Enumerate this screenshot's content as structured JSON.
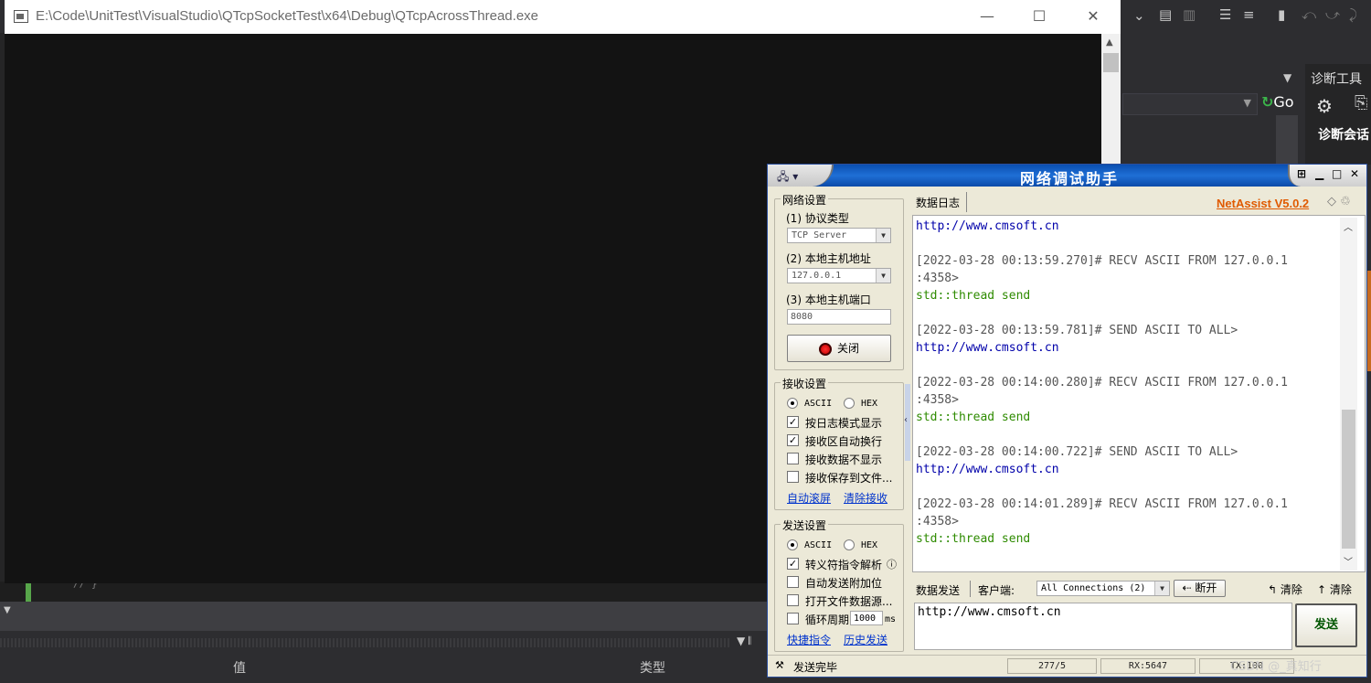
{
  "console": {
    "title": "E:\\Code\\UnitTest\\VisualStudio\\QTcpSocketTest\\x64\\Debug\\QTcpAcrossThread.exe",
    "minimize": "—",
    "maximize": "☐",
    "close": "✕"
  },
  "vs": {
    "go_label": "Go",
    "diag_title": "诊断工具",
    "diag_session": "诊断会话",
    "code_snippet": "//  }",
    "col_value": "值",
    "col_type": "类型"
  },
  "netassist": {
    "title": "网络调试助手",
    "brand": "NetAssist V5.0.2",
    "network": {
      "group_title": "网络设置",
      "protocol_label": "(1) 协议类型",
      "protocol_value": "TCP Server",
      "host_label": "(2) 本地主机地址",
      "host_value": "127.0.0.1",
      "port_label": "(3) 本地主机端口",
      "port_value": "8080",
      "close_button": "关闭"
    },
    "receive": {
      "group_title": "接收设置",
      "ascii": "ASCII",
      "hex": "HEX",
      "log_mode": "按日志模式显示",
      "auto_wrap": "接收区自动换行",
      "no_display": "接收数据不显示",
      "save_file": "接收保存到文件...",
      "auto_scroll": "自动滚屏",
      "clear_receive": "清除接收"
    },
    "send": {
      "group_title": "发送设置",
      "ascii": "ASCII",
      "hex": "HEX",
      "escape_parse": "转义符指令解析",
      "auto_append": "自动发送附加位",
      "open_file": "打开文件数据源...",
      "loop_period": "循环周期",
      "loop_value": "1000",
      "loop_unit": "ms",
      "shortcut": "快捷指令",
      "history": "历史发送"
    },
    "log_tab": "数据日志",
    "log_lines": [
      {
        "kind": "url",
        "text": "http://www.cmsoft.cn"
      },
      {
        "kind": "blank",
        "text": ""
      },
      {
        "kind": "meta",
        "text": "[2022-03-28 00:13:59.270]# RECV ASCII FROM 127.0.0.1"
      },
      {
        "kind": "meta",
        "text": ":4358>"
      },
      {
        "kind": "data",
        "text": "std::thread send"
      },
      {
        "kind": "blank",
        "text": ""
      },
      {
        "kind": "meta",
        "text": "[2022-03-28 00:13:59.781]# SEND ASCII TO ALL>"
      },
      {
        "kind": "url",
        "text": "http://www.cmsoft.cn"
      },
      {
        "kind": "blank",
        "text": ""
      },
      {
        "kind": "meta",
        "text": "[2022-03-28 00:14:00.280]# RECV ASCII FROM 127.0.0.1"
      },
      {
        "kind": "meta",
        "text": ":4358>"
      },
      {
        "kind": "data",
        "text": "std::thread send"
      },
      {
        "kind": "blank",
        "text": ""
      },
      {
        "kind": "meta",
        "text": "[2022-03-28 00:14:00.722]# SEND ASCII TO ALL>"
      },
      {
        "kind": "url",
        "text": "http://www.cmsoft.cn"
      },
      {
        "kind": "blank",
        "text": ""
      },
      {
        "kind": "meta",
        "text": "[2022-03-28 00:14:01.289]# RECV ASCII FROM 127.0.0.1"
      },
      {
        "kind": "meta",
        "text": ":4358>"
      },
      {
        "kind": "data",
        "text": "std::thread send"
      }
    ],
    "send_bar": {
      "tab": "数据发送",
      "client_label": "客户端:",
      "client_value": "All Connections (2)",
      "disconnect": "断开",
      "clear1": "清除",
      "clear2": "清除"
    },
    "send_text": "http://www.cmsoft.cn",
    "send_button": "发送",
    "status": {
      "text": "发送完毕",
      "counter": "277/5",
      "rx": "RX:5647",
      "tx": "TX:100"
    }
  },
  "watermark": "CSDN @_真知行"
}
